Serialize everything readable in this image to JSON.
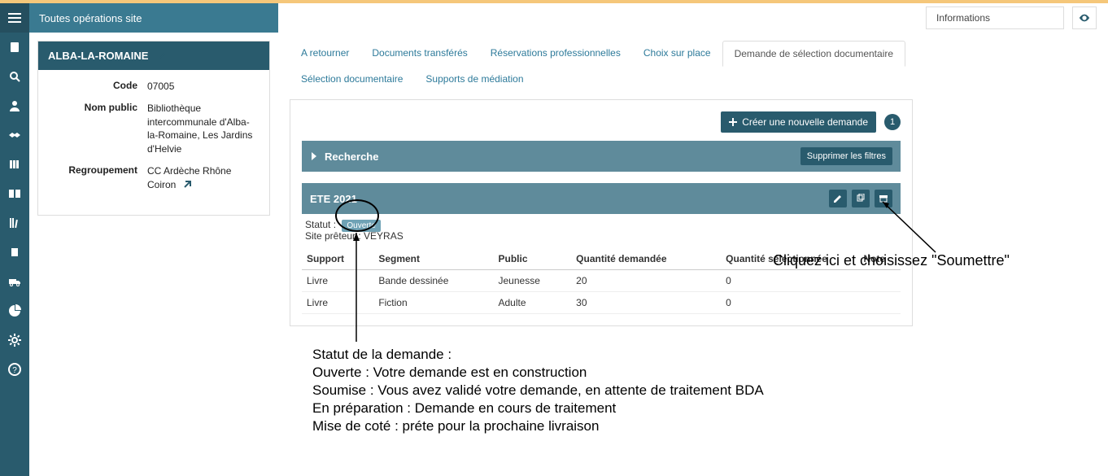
{
  "header": {
    "title": "Toutes opérations site",
    "info_label": "Informations"
  },
  "nav_icons": [
    "menu",
    "book",
    "search",
    "person",
    "handshake",
    "books",
    "open-book",
    "shelf",
    "film",
    "truck",
    "pie",
    "gear",
    "help"
  ],
  "site": {
    "name": "ALBA-LA-ROMAINE",
    "fields": {
      "code_label": "Code",
      "code": "07005",
      "nompublic_label": "Nom public",
      "nompublic": "Bibliothèque intercommunale d'Alba-la-Romaine, Les Jardins d'Helvie",
      "regroup_label": "Regroupement",
      "regroup": "CC Ardèche Rhône Coiron"
    }
  },
  "tabs": {
    "t0": "A retourner",
    "t1": "Documents transférés",
    "t2": "Réservations professionnelles",
    "t3": "Choix sur place",
    "t4": "Demande de sélection documentaire",
    "t5": "Sélection documentaire",
    "t6": "Supports de médiation"
  },
  "actions": {
    "create": "Créer une nouvelle demande",
    "count": "1",
    "search_label": "Recherche",
    "clear_filters": "Supprimer les filtres"
  },
  "request": {
    "title": "ETE 2021",
    "status_label": "Statut :",
    "status_value": "Ouverte",
    "site_label": "Site prêteur : ",
    "site_value": "VEYRAS",
    "cols": {
      "c0": "Support",
      "c1": "Segment",
      "c2": "Public",
      "c3": "Quantité demandée",
      "c4": "Quantité sélectionnée",
      "c5": "Note"
    },
    "rows": [
      {
        "support": "Livre",
        "segment": "Bande dessinée",
        "public": "Jeunesse",
        "qd": "20",
        "qs": "0",
        "note": ""
      },
      {
        "support": "Livre",
        "segment": "Fiction",
        "public": "Adulte",
        "qd": "30",
        "qs": "0",
        "note": ""
      }
    ]
  },
  "anno": {
    "line1": "Cliquez ici et choisissez \"Soumettre\"",
    "block_title": "Statut de la demande :",
    "block_l1": "Ouverte : Votre demande est en construction",
    "block_l2": "Soumise : Vous avez validé votre demande, en attente de traitement BDA",
    "block_l3": "En préparation : Demande en cours de traitement",
    "block_l4": "Mise de coté : préte pour la prochaine livraison"
  }
}
